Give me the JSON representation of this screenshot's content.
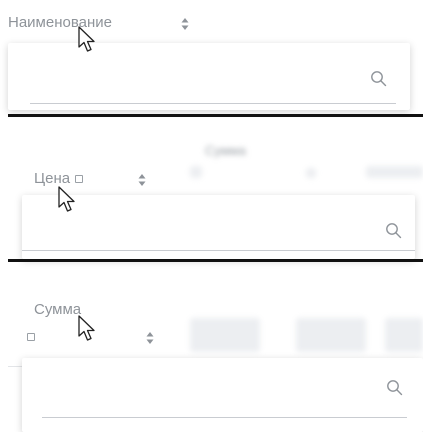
{
  "columns": [
    {
      "id": "name",
      "label": "Наименование",
      "has_checkbox": false
    },
    {
      "id": "price",
      "label": "Цена",
      "has_checkbox": true
    },
    {
      "id": "sum",
      "label": "Сумма",
      "has_checkbox": true
    }
  ],
  "search": {
    "value": "",
    "placeholder": ""
  },
  "icons": {
    "sort": "sort-arrows-icon",
    "search": "magnifier-icon",
    "cursor": "mouse-pointer-icon"
  },
  "colors": {
    "header_text": "#8e9399",
    "rule": "#111111",
    "search_underline": "#c9ccd1"
  }
}
